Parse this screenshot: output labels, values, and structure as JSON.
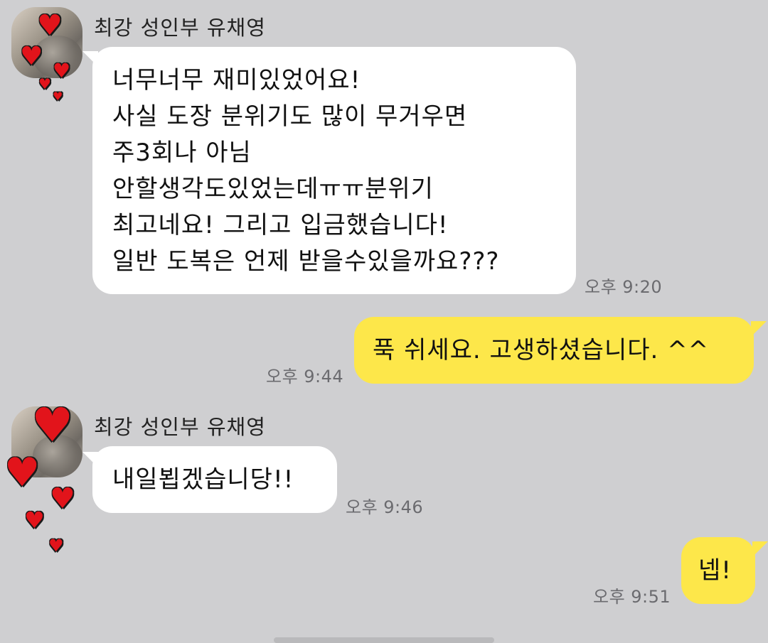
{
  "colors": {
    "background": "#cfcfd1",
    "incoming_bubble": "#ffffff",
    "outgoing_bubble": "#fde74a",
    "timestamp": "#6b6b6f",
    "heart": "#e2141b"
  },
  "messages": [
    {
      "direction": "incoming",
      "sender": "최강 성인부 유채영",
      "lines": [
        "너무너무 재미있었어요!",
        "사실 도장 분위기도 많이 무거우면",
        "주3회나 아님",
        "안할생각도있었는데ㅠㅠ분위기",
        "최고네요! 그리고 입금했습니다!",
        "일반 도복은 언제 받을수있을까요???"
      ],
      "time": "오후 9:20"
    },
    {
      "direction": "outgoing",
      "lines": [
        "푹 쉬세요. 고생하셨습니다. ^^"
      ],
      "time": "오후 9:44"
    },
    {
      "direction": "incoming",
      "sender": "최강 성인부 유채영",
      "lines": [
        "내일뵙겠습니당!!"
      ],
      "time": "오후 9:46"
    },
    {
      "direction": "outgoing",
      "lines": [
        "넵!"
      ],
      "time": "오후 9:51"
    }
  ],
  "icons": {
    "heart": "heart-icon",
    "avatar": "profile-avatar"
  }
}
